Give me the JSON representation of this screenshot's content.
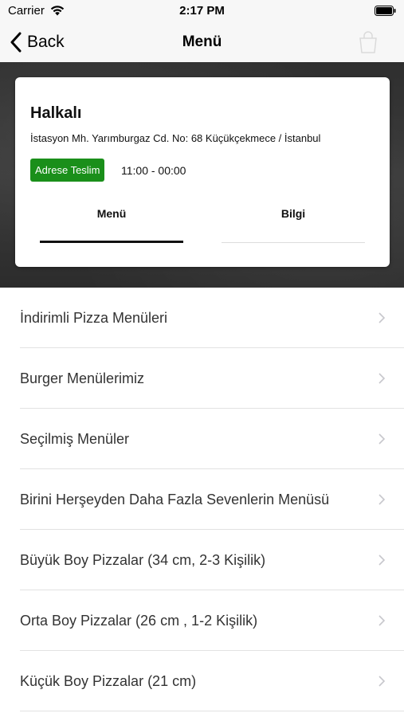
{
  "status_bar": {
    "carrier": "Carrier",
    "time": "2:17 PM",
    "icons": [
      "wifi-icon",
      "battery-icon"
    ]
  },
  "nav": {
    "back_label": "Back",
    "title": "Menü",
    "icons": [
      "chevron-left-icon",
      "cart-icon"
    ]
  },
  "restaurant": {
    "name": "Halkalı",
    "address": "İstasyon Mh. Yarımburgaz Cd. No: 68 Küçükçekmece / İstanbul",
    "delivery_badge": "Adrese Teslim",
    "badge_color": "#1a8f1a",
    "hours": "11:00 - 00:00"
  },
  "tabs": [
    {
      "label": "Menü",
      "active": true
    },
    {
      "label": "Bilgi",
      "active": false
    }
  ],
  "categories": [
    {
      "label": "İndirimli Pizza Menüleri"
    },
    {
      "label": "Burger Menülerimiz"
    },
    {
      "label": "Seçilmiş Menüler"
    },
    {
      "label": "Birini Herşeyden Daha Fazla Sevenlerin Menüsü"
    },
    {
      "label": "Büyük Boy Pizzalar (34 cm, 2-3 Kişilik)"
    },
    {
      "label": "Orta Boy Pizzalar (26 cm , 1-2 Kişilik)"
    },
    {
      "label": "Küçük Boy Pizzalar (21 cm)"
    }
  ]
}
